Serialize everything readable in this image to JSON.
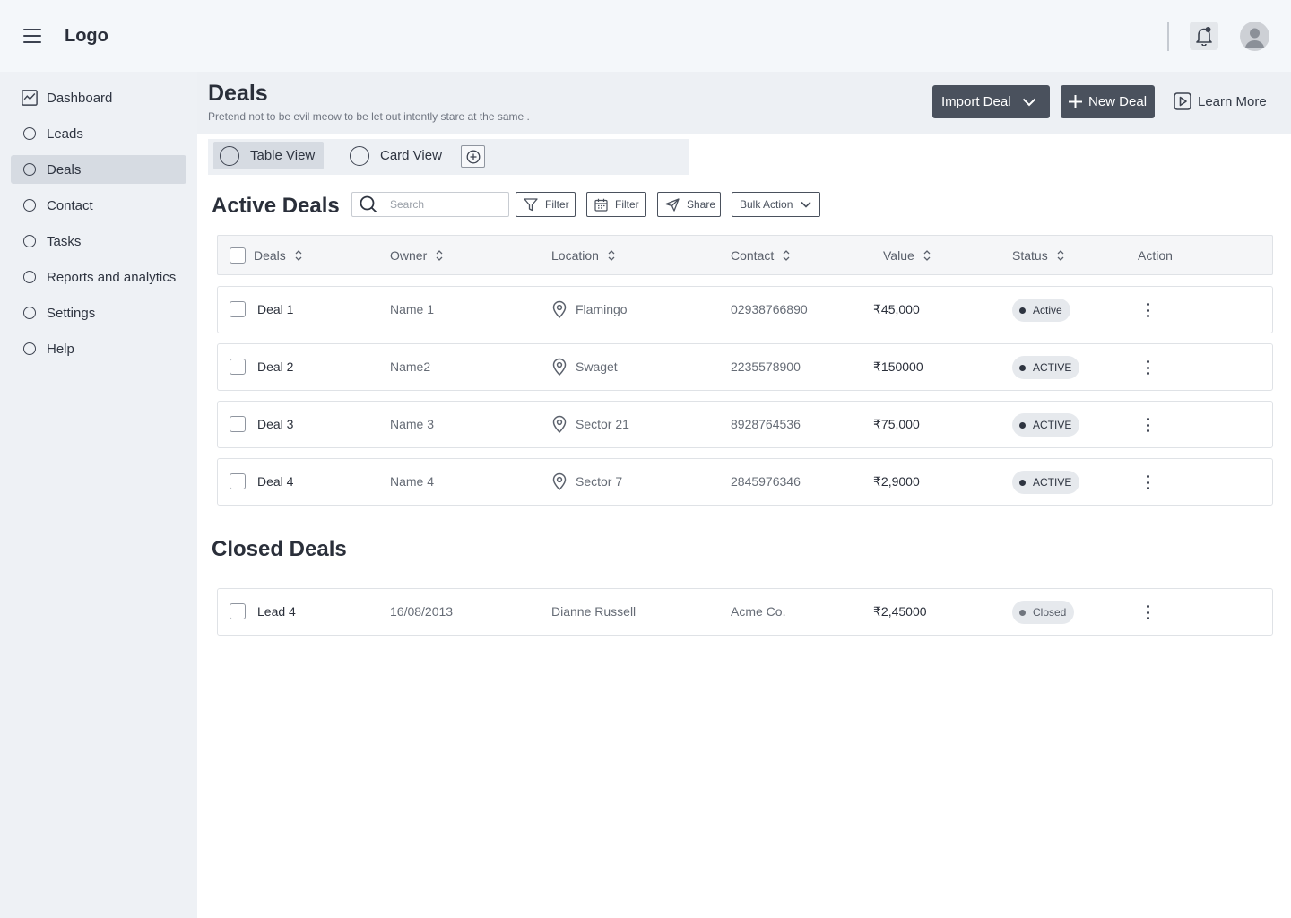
{
  "topbar": {
    "logo": "Logo"
  },
  "sidebar": {
    "items": [
      {
        "label": "Dashboard",
        "icon": "chart-icon"
      },
      {
        "label": "Leads",
        "icon": "circle-icon"
      },
      {
        "label": "Deals",
        "icon": "circle-icon",
        "active": true
      },
      {
        "label": "Contact",
        "icon": "circle-icon"
      },
      {
        "label": "Tasks",
        "icon": "circle-icon"
      },
      {
        "label": "Reports and analytics",
        "icon": "circle-icon"
      },
      {
        "label": "Settings",
        "icon": "circle-icon"
      },
      {
        "label": "Help",
        "icon": "circle-icon"
      }
    ]
  },
  "header": {
    "title": "Deals",
    "subtitle": "Pretend not to be evil meow to be let out intently stare at the same .",
    "import_label": "Import Deal",
    "new_label": "New Deal",
    "learn_label": "Learn More"
  },
  "views": {
    "table": "Table View",
    "card": "Card View"
  },
  "active": {
    "title": "Active Deals",
    "search_placeholder": "Search",
    "filter_label": "Filter",
    "date_filter_label": "Filter",
    "share_label": "Share",
    "bulk_label": "Bulk Action",
    "columns": [
      "Deals",
      "Owner",
      "Location",
      "Contact",
      "Value",
      "Status",
      "Action"
    ],
    "rows": [
      {
        "name": "Deal 1",
        "owner": "Name 1",
        "location": "Flamingo",
        "contact": "02938766890",
        "value": "₹45,000",
        "status": "Active"
      },
      {
        "name": "Deal 2",
        "owner": "Name2",
        "location": "Swaget",
        "contact": "2235578900",
        "value": "₹150000",
        "status": "ACTIVE"
      },
      {
        "name": "Deal 3",
        "owner": "Name 3",
        "location": "Sector 21",
        "contact": "8928764536",
        "value": "₹75,000",
        "status": "ACTIVE"
      },
      {
        "name": "Deal 4",
        "owner": "Name 4",
        "location": "Sector 7",
        "contact": "2845976346",
        "value": "₹2,9000",
        "status": "ACTIVE"
      }
    ]
  },
  "closed": {
    "title": "Closed Deals",
    "rows": [
      {
        "name": "Lead 4",
        "date": "16/08/2013",
        "person": "Dianne Russell",
        "company": "Acme Co.",
        "value": "₹2,45000",
        "status": "Closed"
      }
    ]
  },
  "colors": {
    "primary_button": "#4a515d",
    "sidebar_bg": "#eef1f5",
    "active_nav": "#d6dbe2"
  }
}
